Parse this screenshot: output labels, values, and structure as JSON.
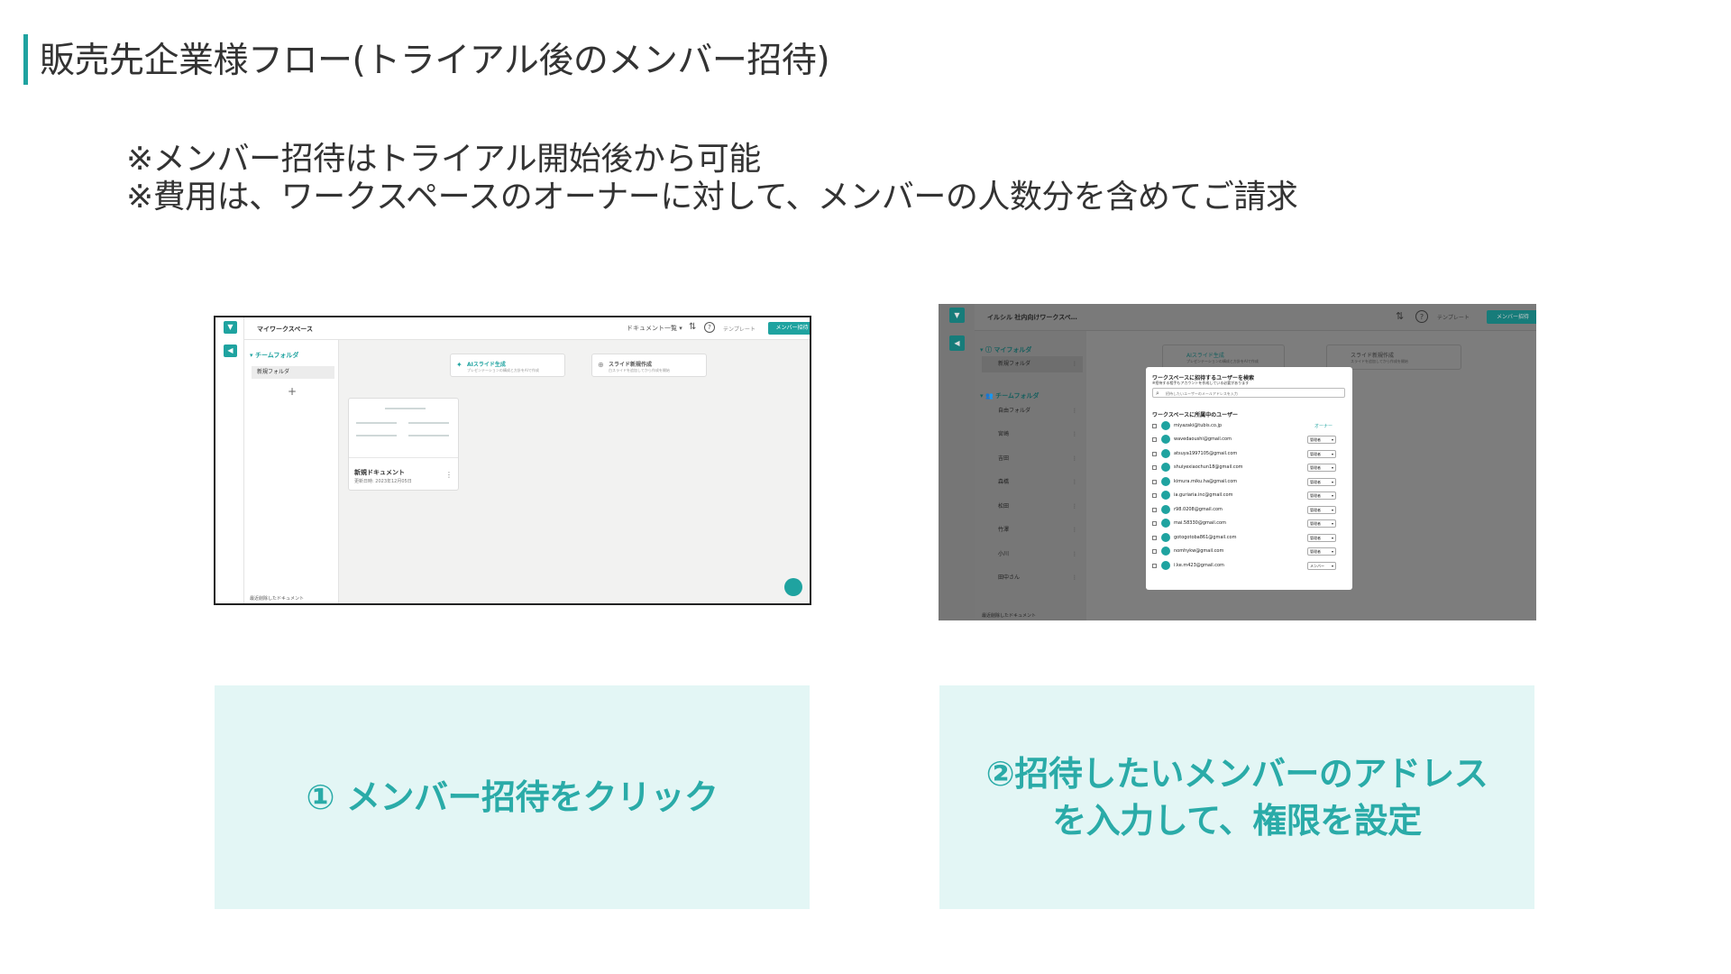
{
  "page": {
    "title": "販売先企業様フロー(トライアル後のメンバー招待)",
    "notes": [
      "※メンバー招待はトライアル開始後から可能",
      "※費用は、ワークスペースのオーナーに対して、メンバーの人数分を含めてご請求"
    ],
    "accent_color": "#1fa3a0"
  },
  "screenshot1": {
    "workspace_name": "マイワークスペース",
    "doc_filter": "ドキュメント一覧 ▾",
    "sort_icon": "sort-icon",
    "help_icon": "help-icon",
    "template_label": "テンプレート",
    "invite_button": "メンバー招待",
    "sidebar": {
      "team_folder": "▾ チームフォルダ",
      "folder": "新規フォルダ",
      "add": "+",
      "trash": "最近削除したドキュメント"
    },
    "cards": [
      {
        "icon": "ai-sparkle-icon",
        "title": "AIスライド生成",
        "subtitle": "プレゼンテーションの構成と方針をAIで作成"
      },
      {
        "icon": "add-circle-icon",
        "title": "スライド新規作成",
        "subtitle": "白スライドを追加してから作成を開始"
      }
    ],
    "document": {
      "name": "新規ドキュメント",
      "date": "更新日時: 2023年12月05日"
    }
  },
  "screenshot2": {
    "workspace_name": "イルシル 社内向けワークスペ…",
    "help_icon": "help-icon",
    "template_label": "テンプレート",
    "invite_button": "メンバー招待",
    "sidebar": {
      "my_folder": "▾ ⓘ マイフォルダ",
      "my_folder_item": "新規フォルダ",
      "team_folder": "▾ 👥 チームフォルダ",
      "items": [
        "自由フォルダ",
        "宮崎",
        "吉田",
        "森橋",
        "松田",
        "竹澤",
        "小川",
        "田中さん"
      ],
      "trash": "最近削除したドキュメント"
    },
    "cards": [
      {
        "title": "AIスライド生成",
        "subtitle": "プレゼンテーションの構成と方針をAIで作成"
      },
      {
        "title": "スライド新規作成",
        "subtitle": "スライドを追加してから作成を開始"
      }
    ],
    "modal": {
      "title": "ワークスペースに招待するユーザーを検索",
      "subtitle": "※招待する相手もアカウントを作成している必要があります",
      "search_placeholder": "招待したいユーザーのメールアドレスを入力",
      "list_title": "ワークスペースに所属中のユーザー",
      "users": [
        {
          "email": "miyazaki@tubis.co.jp",
          "role": "オーナー",
          "owner": true
        },
        {
          "email": "wavedaoushi@gmail.com",
          "role": "管理者"
        },
        {
          "email": "atsuya1997105@gmail.com",
          "role": "管理者"
        },
        {
          "email": "shuiyexiaochun18@gmail.com",
          "role": "管理者"
        },
        {
          "email": "kimura.miku.ha@gmail.com",
          "role": "管理者"
        },
        {
          "email": "ia.guriaria.inc@gmail.com",
          "role": "管理者"
        },
        {
          "email": "r98.0208@gmail.com",
          "role": "管理者"
        },
        {
          "email": "mai.58330@gmail.com",
          "role": "管理者"
        },
        {
          "email": "gotogotoba861@gmail.com",
          "role": "管理者"
        },
        {
          "email": "nomhykw@gmail.com",
          "role": "管理者"
        },
        {
          "email": "i.ke.m423@gmail.com",
          "role": "メンバー"
        }
      ]
    }
  },
  "captions": {
    "step1": "① メンバー招待をクリック",
    "step2_line1": "②招待したいメンバーのアドレス",
    "step2_line2": "を入力して、権限を設定"
  }
}
